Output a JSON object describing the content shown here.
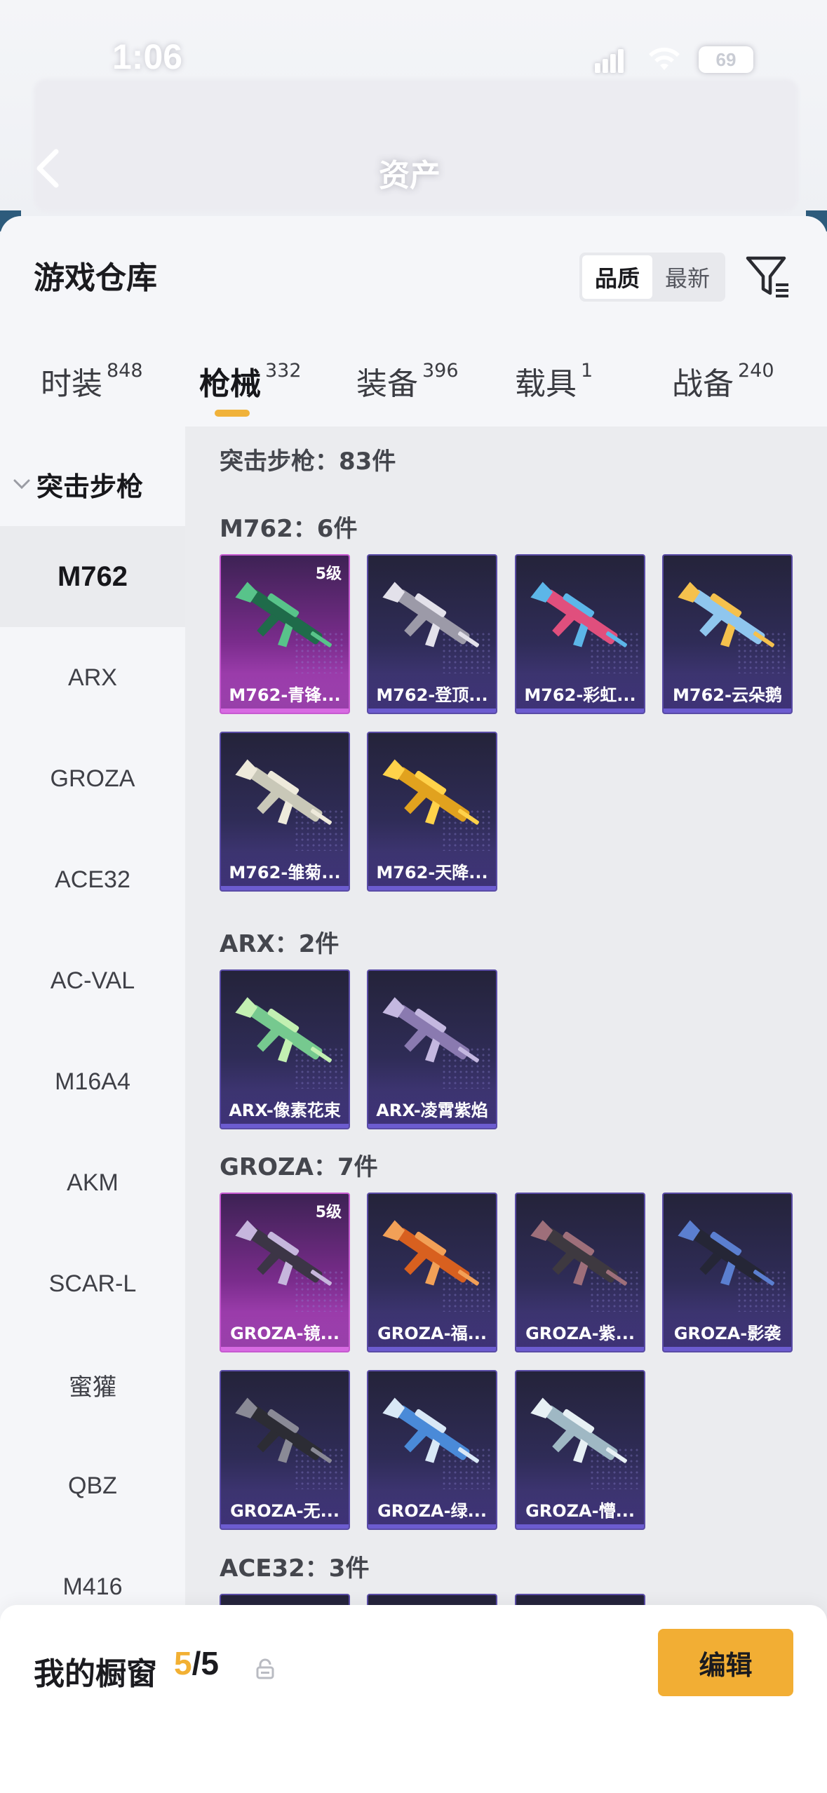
{
  "status_bar": {
    "time": "1:06",
    "battery": "69"
  },
  "nav": {
    "title": "资产"
  },
  "header": {
    "title": "游戏仓库",
    "sort": [
      "品质",
      "最新"
    ],
    "sort_active": 0
  },
  "tabs": [
    {
      "label": "时装",
      "count": "848"
    },
    {
      "label": "枪械",
      "count": "332",
      "active": true
    },
    {
      "label": "装备",
      "count": "396"
    },
    {
      "label": "载具",
      "count": "1"
    },
    {
      "label": "战备",
      "count": "240"
    }
  ],
  "sidebar": {
    "header": "突击步枪",
    "items": [
      "M762",
      "ARX",
      "GROZA",
      "ACE32",
      "AC-VAL",
      "M16A4",
      "AKM",
      "SCAR-L",
      "蜜獾",
      "QBZ",
      "M416"
    ],
    "active": 0
  },
  "content": {
    "total": "突击步枪：83件",
    "groups": [
      {
        "title": "M762：6件",
        "items": [
          {
            "name": "M762-青锋...",
            "level": "5级",
            "rarity": "gold",
            "colors": [
              "#1f6b4a",
              "#58c38a"
            ]
          },
          {
            "name": "M762-登顶...",
            "rarity": "purple",
            "colors": [
              "#9c9aa8",
              "#e3e1ea"
            ]
          },
          {
            "name": "M762-彩虹...",
            "rarity": "purple",
            "colors": [
              "#e04f7d",
              "#5cb6e8"
            ]
          },
          {
            "name": "M762-云朵鹅",
            "rarity": "purple",
            "colors": [
              "#8fc6ee",
              "#f5c14d"
            ]
          },
          {
            "name": "M762-雏菊...",
            "rarity": "purple",
            "colors": [
              "#c9c8b8",
              "#eeeadb"
            ]
          },
          {
            "name": "M762-天降...",
            "rarity": "purple",
            "colors": [
              "#e1a21e",
              "#ffd24a"
            ]
          }
        ]
      },
      {
        "title": "ARX：2件",
        "items": [
          {
            "name": "ARX-像素花束",
            "rarity": "purple",
            "colors": [
              "#76c98f",
              "#c3f0b2"
            ]
          },
          {
            "name": "ARX-凌霄紫焰",
            "rarity": "purple",
            "colors": [
              "#8a7ab0",
              "#c4b8e0"
            ]
          }
        ]
      },
      {
        "title": "GROZA：7件",
        "items": [
          {
            "name": "GROZA-镜...",
            "level": "5级",
            "rarity": "gold",
            "colors": [
              "#3c3546",
              "#c6b6dd"
            ]
          },
          {
            "name": "GROZA-福...",
            "rarity": "purple",
            "colors": [
              "#d8601f",
              "#f2a057"
            ]
          },
          {
            "name": "GROZA-紫...",
            "rarity": "purple",
            "colors": [
              "#3e3940",
              "#9e6f7a"
            ]
          },
          {
            "name": "GROZA-影袭",
            "rarity": "purple",
            "colors": [
              "#252636",
              "#5b7fd0"
            ]
          },
          {
            "name": "GROZA-无...",
            "rarity": "purple",
            "colors": [
              "#2c2c34",
              "#8a8a96"
            ]
          },
          {
            "name": "GROZA-绿...",
            "rarity": "purple",
            "colors": [
              "#4a8ad8",
              "#d9e8f6"
            ]
          },
          {
            "name": "GROZA-懵...",
            "rarity": "purple",
            "colors": [
              "#9fb8c4",
              "#e7f0f4"
            ]
          }
        ]
      },
      {
        "title": "ACE32：3件",
        "items": [
          {
            "name": "",
            "rarity": "purple",
            "colors": [
              "#2f2c57",
              "#2f2c57"
            ]
          },
          {
            "name": "",
            "rarity": "purple",
            "colors": [
              "#2f2c57",
              "#2f2c57"
            ]
          },
          {
            "name": "",
            "rarity": "purple",
            "colors": [
              "#2f2c57",
              "#2f2c57"
            ]
          }
        ]
      }
    ]
  },
  "bottom": {
    "label": "我的橱窗",
    "current": "5",
    "total": "/5",
    "edit": "编辑"
  },
  "colors": {
    "accent": "#f2ae34",
    "purple_card": "#2f2c57",
    "gold_card": "#c14fcf"
  }
}
